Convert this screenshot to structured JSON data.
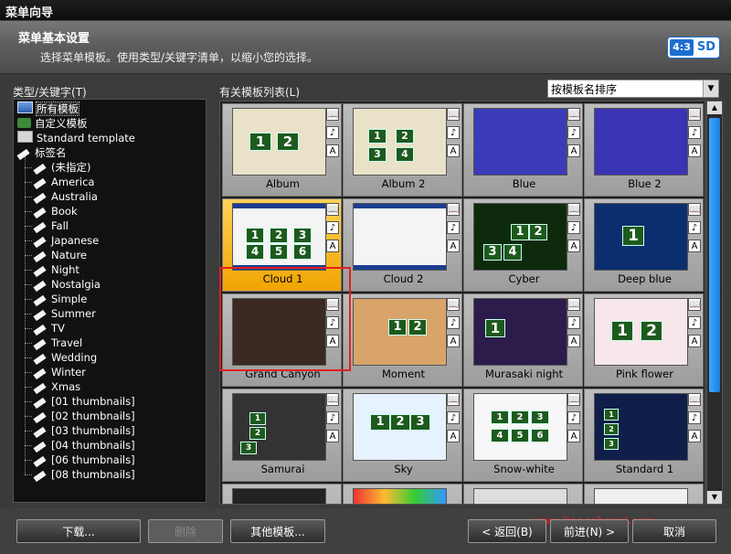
{
  "window": {
    "title": "菜单向导"
  },
  "header": {
    "title": "菜单基本设置",
    "subtitle": "选择菜单模板。使用类型/关键字清单，以缩小您的选择。",
    "aspect_ratio": "4:3",
    "format": "SD"
  },
  "tree": {
    "label": "类型/关键字(T)",
    "items": [
      {
        "label": "所有模板",
        "icon": "all-templates-icon",
        "selected": true
      },
      {
        "label": "自定义模板",
        "icon": "custom-template-icon"
      },
      {
        "label": "Standard template",
        "icon": "standard-template-icon"
      },
      {
        "label": "标签名",
        "icon": "tag-icon"
      }
    ],
    "tags": [
      "(未指定)",
      "America",
      "Australia",
      "Book",
      "Fall",
      "Japanese",
      "Nature",
      "Night",
      "Nostalgia",
      "Simple",
      "Summer",
      "TV",
      "Travel",
      "Wedding",
      "Winter",
      "Xmas",
      "[01 thumbnails]",
      "[02 thumbnails]",
      "[03 thumbnails]",
      "[04 thumbnails]",
      "[06 thumbnails]",
      "[08 thumbnails]"
    ]
  },
  "templates": {
    "label": "有关模板列表(L)",
    "sort_selected": "按模板名排序",
    "side_icons": [
      "book-icon",
      "music-note-icon",
      "text-a-icon"
    ],
    "side_glyphs": [
      "📖",
      "♪",
      "A"
    ],
    "items": [
      {
        "name": "Album",
        "bg": "#e9e2c9"
      },
      {
        "name": "Album 2",
        "bg": "#e9e2c9"
      },
      {
        "name": "Blue",
        "bg": "#3b3ab8"
      },
      {
        "name": "Blue 2",
        "bg": "#3a33b3"
      },
      {
        "name": "Cloud 1",
        "bg": "#f4f4f4",
        "selected": true
      },
      {
        "name": "Cloud 2",
        "bg": "#f4f4f4"
      },
      {
        "name": "Cyber",
        "bg": "#0d2a0d"
      },
      {
        "name": "Deep blue",
        "bg": "#0b2e6e"
      },
      {
        "name": "Grand Canyon",
        "bg": "#3a2a22"
      },
      {
        "name": "Moment",
        "bg": "#d9a46a"
      },
      {
        "name": "Murasaki night",
        "bg": "#2c1c4c"
      },
      {
        "name": "Pink flower",
        "bg": "#f7e6ea"
      },
      {
        "name": "Samurai",
        "bg": "#333333"
      },
      {
        "name": "Sky",
        "bg": "#e6f2ff"
      },
      {
        "name": "Snow-white",
        "bg": "#f7f7f7"
      },
      {
        "name": "Standard 1",
        "bg": "#0f1f4a"
      }
    ]
  },
  "footer": {
    "download": "下载...",
    "delete": "删除",
    "other": "其他模板...",
    "back": "< 返回(B)",
    "next": "前进(N) >",
    "cancel": "取消",
    "watermark": "www.jiangshanxi.com"
  }
}
